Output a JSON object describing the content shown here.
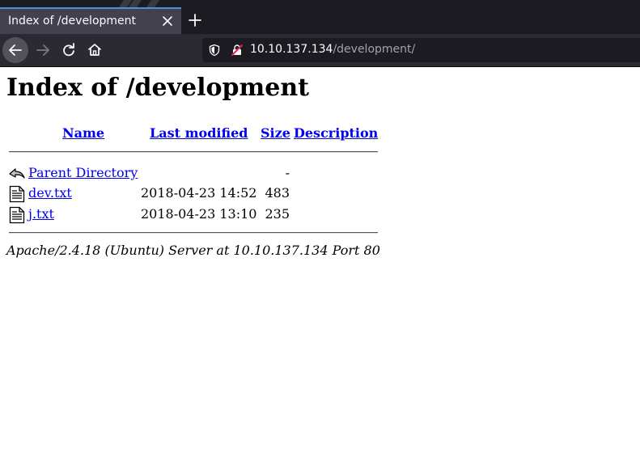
{
  "browser": {
    "tab_title": "Index of /development",
    "url_host": "10.10.137.134",
    "url_path": "/development/"
  },
  "listing": {
    "heading": "Index of /development",
    "columns": {
      "name": "Name",
      "last_modified": "Last modified",
      "size": "Size",
      "description": "Description"
    },
    "parent": {
      "name": "Parent Directory",
      "size": "-",
      "icon": "back-arrow-icon"
    },
    "files": [
      {
        "name": "dev.txt",
        "modified": "2018-04-23 14:52",
        "size": "483",
        "icon": "text-file-icon"
      },
      {
        "name": "j.txt",
        "modified": "2018-04-23 13:10",
        "size": "235",
        "icon": "text-file-icon"
      }
    ],
    "server_signature": "Apache/2.4.18 (Ubuntu) Server at 10.10.137.134 Port 80"
  }
}
